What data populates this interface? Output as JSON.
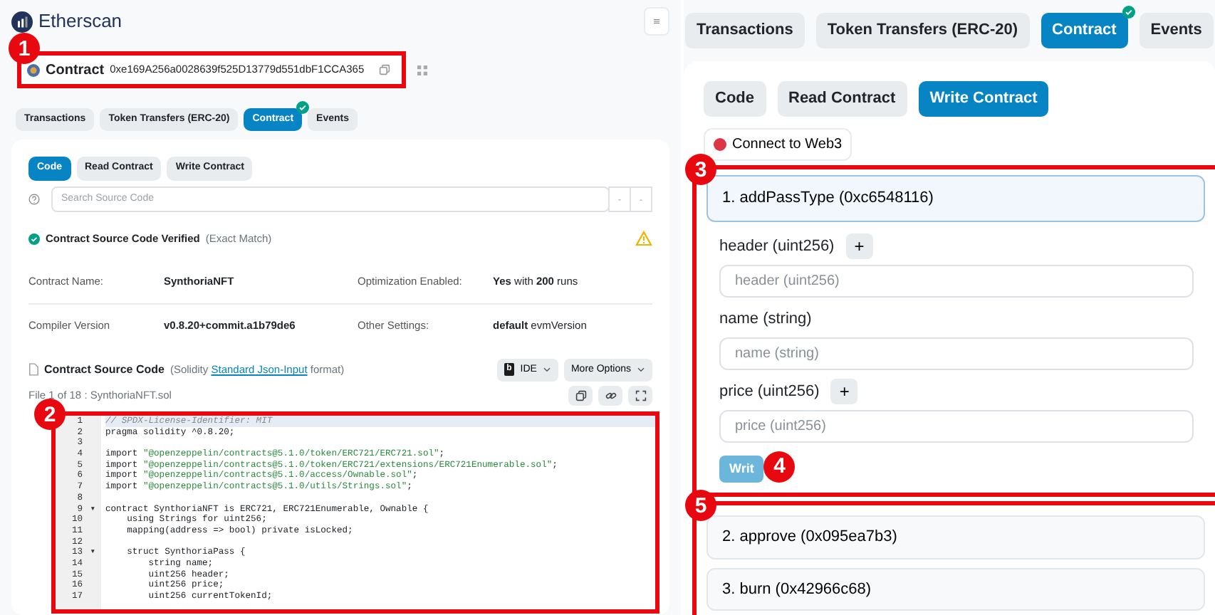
{
  "callouts": [
    "1",
    "2",
    "3",
    "4",
    "5"
  ],
  "left_panel": {
    "logo_text": "Etherscan",
    "contract": {
      "label": "Contract",
      "address": "0xe169A256a0028639f525D13779d551dbF1CCA365"
    },
    "tabs": [
      {
        "label": "Transactions",
        "selected": false,
        "verified": false
      },
      {
        "label": "Token Transfers (ERC-20)",
        "selected": false,
        "verified": false
      },
      {
        "label": "Contract",
        "selected": true,
        "verified": true
      },
      {
        "label": "Events",
        "selected": false,
        "verified": false
      }
    ],
    "subtabs": [
      {
        "label": "Code",
        "selected": true
      },
      {
        "label": "Read Contract",
        "selected": false
      },
      {
        "label": "Write Contract",
        "selected": false
      }
    ],
    "search": {
      "placeholder": "Search Source Code"
    },
    "verification": {
      "title": "Contract Source Code Verified",
      "note": "(Exact Match)"
    },
    "details": [
      {
        "label": "Contract Name:",
        "value": "SynthoriaNFT",
        "bold": true
      },
      {
        "label": "Optimization Enabled:",
        "value": "**Yes** with **200** runs",
        "bold": false
      },
      {
        "label": "Compiler Version",
        "value": "v0.8.20+commit.a1b79de6",
        "bold": true
      },
      {
        "label": "Other Settings:",
        "value": "**default** evmVersion",
        "bold": false
      }
    ],
    "source": {
      "title": "Contract Source Code",
      "note_before": "(Solidity",
      "link": "Standard Json-Input",
      "note_after": "format)",
      "ide_button": "IDE",
      "ide_logo": "b",
      "more_button": "More Options",
      "file": "File 1 of 18 : SynthoriaNFT.sol"
    },
    "code": [
      {
        "n": "1",
        "text": "// SPDX-License-Identifier: MIT",
        "kind": "comment"
      },
      {
        "n": "2",
        "text": "pragma solidity ^0.8.20;",
        "kind": "code"
      },
      {
        "n": "3"
      },
      {
        "n": "4",
        "text": "import \"@openzeppelin/contracts@5.1.0/token/ERC721/ERC721.sol\";",
        "kind": "code"
      },
      {
        "n": "5",
        "text": "import \"@openzeppelin/contracts@5.1.0/token/ERC721/extensions/ERC721Enumerable.sol\";",
        "kind": "code"
      },
      {
        "n": "6",
        "text": "import \"@openzeppelin/contracts@5.1.0/access/Ownable.sol\";",
        "kind": "code"
      },
      {
        "n": "7",
        "text": "import \"@openzeppelin/contracts@5.1.0/utils/Strings.sol\";",
        "kind": "code"
      },
      {
        "n": "8"
      },
      {
        "n": "9",
        "text": "contract SynthoriaNFT is ERC721, ERC721Enumerable, Ownable {",
        "kind": "code",
        "fold": "▾"
      },
      {
        "n": "10",
        "text": "    using Strings for uint256;",
        "kind": "code"
      },
      {
        "n": "11",
        "text": "    mapping(address => bool) private isLocked;",
        "kind": "code"
      },
      {
        "n": "12"
      },
      {
        "n": "13",
        "text": "    struct SynthoriaPass {",
        "kind": "code",
        "fold": "▾"
      },
      {
        "n": "14",
        "text": "        string name;",
        "kind": "code"
      },
      {
        "n": "15",
        "text": "        uint256 header;",
        "kind": "code"
      },
      {
        "n": "16",
        "text": "        uint256 price;",
        "kind": "code"
      },
      {
        "n": "17",
        "text": "        uint256 currentTokenId;",
        "kind": "code"
      }
    ]
  },
  "right_panel": {
    "tabs": [
      {
        "label": "Transactions",
        "selected": false,
        "verified": false
      },
      {
        "label": "Token Transfers (ERC-20)",
        "selected": false,
        "verified": false
      },
      {
        "label": "Contract",
        "selected": true,
        "verified": true
      },
      {
        "label": "Events",
        "selected": false,
        "verified": false
      }
    ],
    "subtabs": [
      {
        "label": "Code",
        "selected": false
      },
      {
        "label": "Read Contract",
        "selected": false
      },
      {
        "label": "Write Contract",
        "selected": true
      }
    ],
    "connect": {
      "label": "Connect to Web3",
      "connected": false
    },
    "functions": [
      {
        "title": "1. addPassType (0xc6548116)",
        "expanded": true,
        "inputs": [
          {
            "label": "header (uint256)",
            "placeholder": "header (uint256)",
            "add_button": "+"
          },
          {
            "label": "name (string)",
            "placeholder": "name (string)"
          },
          {
            "label": "price (uint256)",
            "placeholder": "price (uint256)",
            "add_button": "+"
          }
        ],
        "button": "Writ"
      },
      {
        "title": "2. approve (0x095ea7b3)",
        "expanded": false
      },
      {
        "title": "3. burn (0x42966c68)",
        "expanded": false
      }
    ]
  }
}
